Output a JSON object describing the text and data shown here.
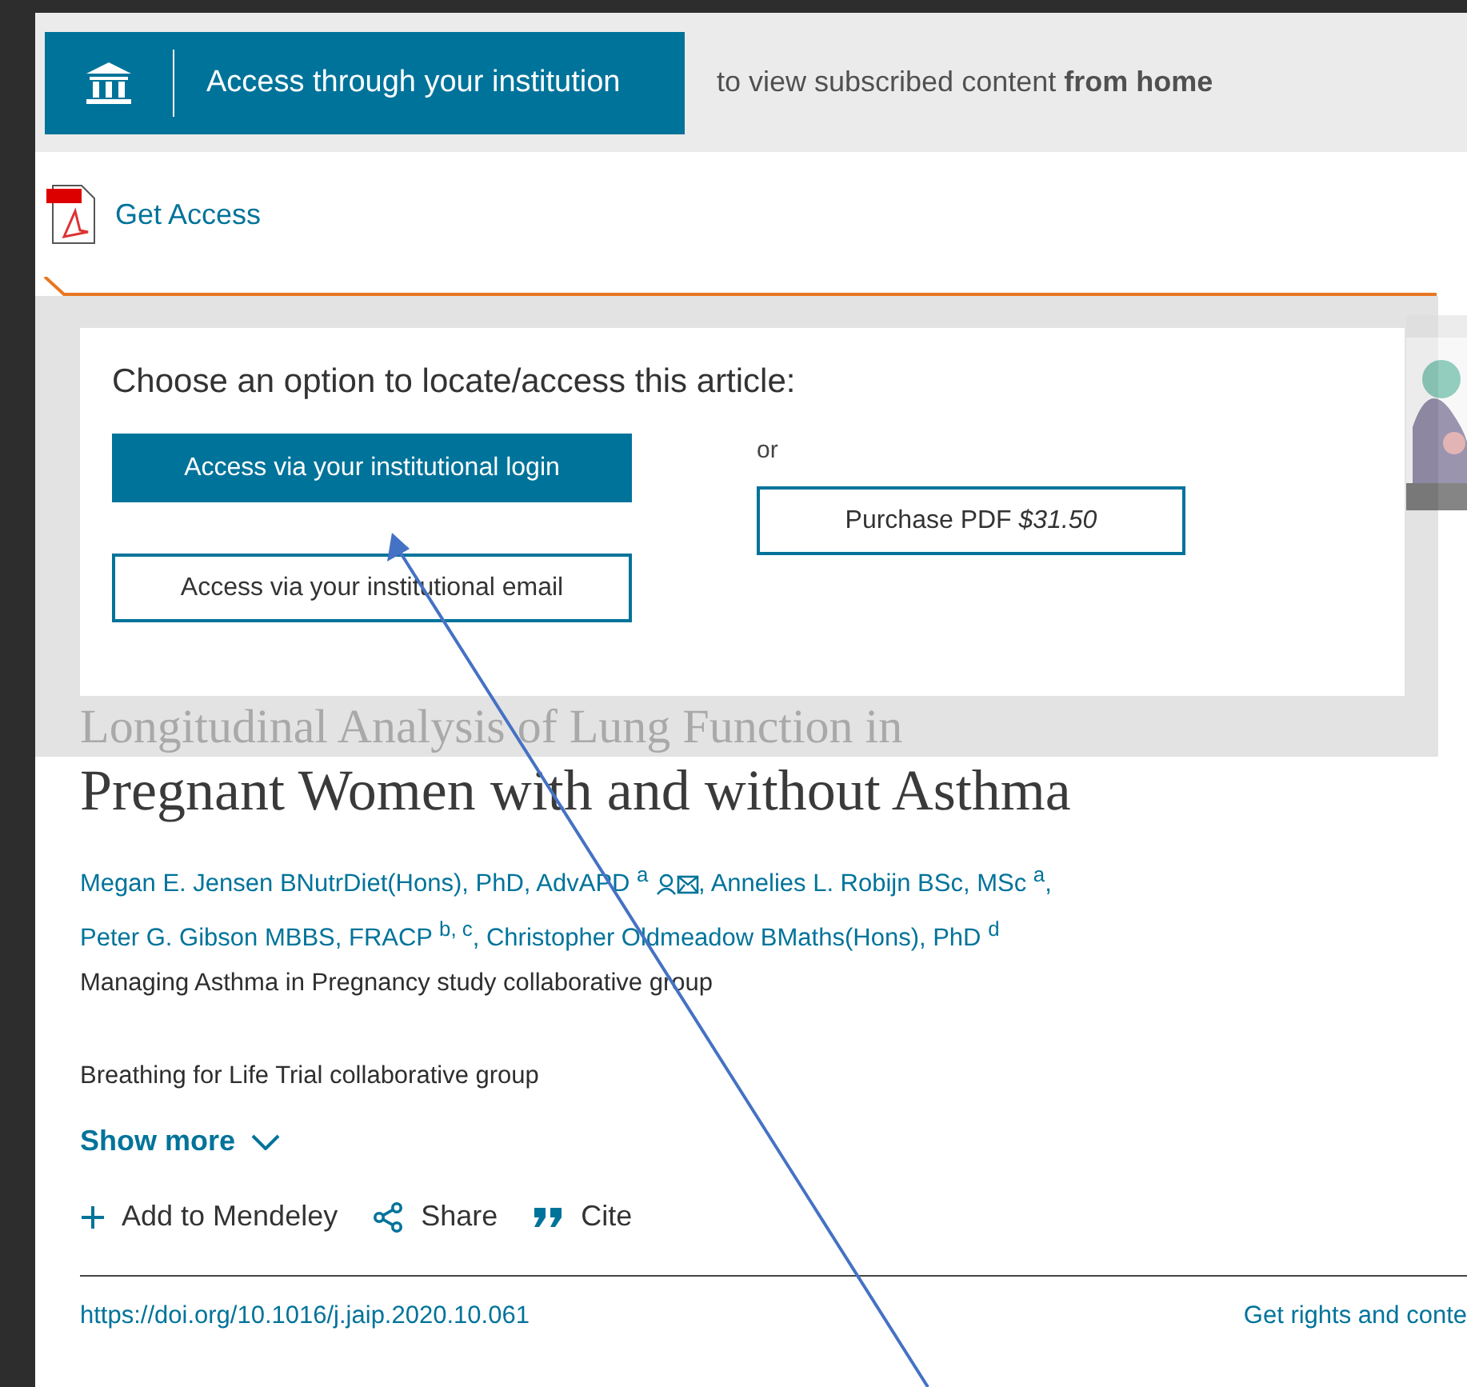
{
  "banner": {
    "button": "Access through your institution",
    "note": "to view subscribed content **from home**"
  },
  "get_access": {
    "label": "Get Access"
  },
  "dialog": {
    "heading": "Choose an option to locate/access this article:",
    "options": [
      {
        "label": "Access via your institutional login",
        "primary": true
      },
      {
        "label": "Access via your institutional email",
        "primary": false
      }
    ],
    "or": "or",
    "purchase": "Purchase PDF *$31.50*"
  },
  "background_title": "Longitudinal Analysis of Lung Function in",
  "article": {
    "title": "Pregnant Women with and without Asthma",
    "authors": [
      {
        "name": "Megan E. Jensen BNutrDiet(Hons), PhD, AdvAPD $^{a}$",
        "contact_icons": true,
        "trailing": ","
      },
      {
        "name": "Annelies L. Robijn BSc, MSc $^{a}$,",
        "contact_icons": false
      },
      {
        "name": "Peter G. Gibson MBBS, FRACP $^{b, c}$,",
        "contact_icons": false
      },
      {
        "name": "Christopher Oldmeadow BMaths(Hons), PhD $^{d}$",
        "contact_icons": false
      }
    ],
    "groups": [
      "Managing Asthma in Pregnancy study collaborative group",
      "Breathing for Life Trial collaborative group"
    ],
    "show_more": "Show more",
    "actions": [
      {
        "kind": "add",
        "label": "Add to Mendeley"
      },
      {
        "kind": "share",
        "label": "Share"
      },
      {
        "kind": "cite",
        "label": "Cite"
      }
    ],
    "doi": "https://doi.org/10.1016/j.jaip.2020.10.061",
    "rights": "Get rights and conte"
  }
}
